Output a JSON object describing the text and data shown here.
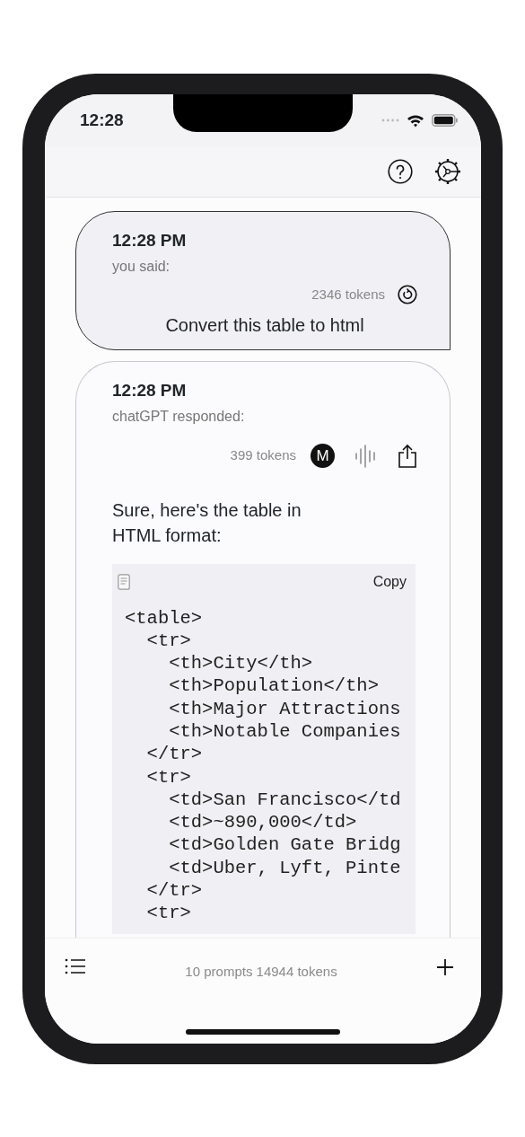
{
  "status_bar": {
    "time": "12:28"
  },
  "messages": [
    {
      "kind": "prompt",
      "time": "12:28 PM",
      "author_label": "you said:",
      "tokens": "2346 tokens",
      "text": "Convert this table to html"
    },
    {
      "kind": "response",
      "time": "12:28 PM",
      "author_label": "chatGPT responded:",
      "tokens": "399 tokens",
      "model_badge": "M",
      "text": "Sure, here's the table in HTML format:",
      "code": {
        "copy_label": "Copy",
        "lines": [
          "<table>",
          "  <tr>",
          "    <th>City</th>",
          "    <th>Population</th>",
          "    <th>Major Attractions",
          "    <th>Notable Companies",
          "  </tr>",
          "  <tr>",
          "    <td>San Francisco</td",
          "    <td>~890,000</td>",
          "    <td>Golden Gate Bridg",
          "    <td>Uber, Lyft, Pinte",
          "  </tr>",
          "  <tr>"
        ]
      }
    }
  ],
  "footer": {
    "summary": "10 prompts 14944 tokens"
  }
}
